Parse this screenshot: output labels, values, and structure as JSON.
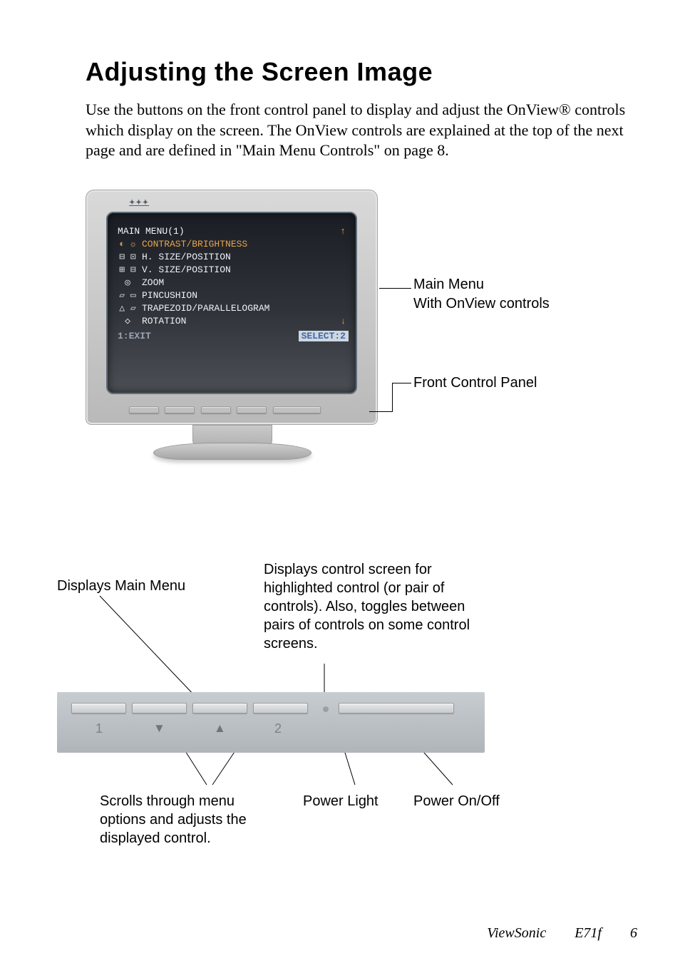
{
  "title": "Adjusting the Screen Image",
  "intro": "Use the buttons on the front control panel to display and adjust the OnView® controls which display on the screen. The OnView controls are explained at the top of the next page and are defined in \"Main Menu Controls\" on page  8.",
  "monitor": {
    "brand_glyph": "✦✦✦",
    "osd": {
      "title": "MAIN MENU(1)",
      "items": [
        {
          "icons": "◐ ☼",
          "label": "CONTRAST/BRIGHTNESS",
          "highlight": true
        },
        {
          "icons": "⊟ ⊡",
          "label": "H. SIZE/POSITION",
          "highlight": false
        },
        {
          "icons": "⊞ ⊟",
          "label": "V. SIZE/POSITION",
          "highlight": false
        },
        {
          "icons": "◎",
          "label": "ZOOM",
          "highlight": false
        },
        {
          "icons": "▱ ▭",
          "label": "PINCUSHION",
          "highlight": false
        },
        {
          "icons": "△ ▱",
          "label": "TRAPEZOID/PARALLELOGRAM",
          "highlight": false
        },
        {
          "icons": "◇",
          "label": "ROTATION",
          "highlight": false
        }
      ],
      "exit_label": "1:EXIT",
      "select_label": "SELECT:2"
    },
    "side_label_title": "Main Menu",
    "side_label_sub": "With OnView controls",
    "front_panel_label": "Front Control Panel"
  },
  "panel": {
    "label_main_menu": "Displays Main Menu",
    "label_control_screen": "Displays control screen for highlighted control (or pair of controls). Also, toggles between pairs of controls on some control screens.",
    "button_labels": {
      "one": "1",
      "two": "2"
    },
    "label_scroll": "Scrolls through menu options and adjusts the displayed control.",
    "label_power_light": "Power Light",
    "label_power_onoff": "Power On/Off"
  },
  "footer": {
    "brand": "ViewSonic",
    "model": "E71f",
    "page": "6"
  }
}
